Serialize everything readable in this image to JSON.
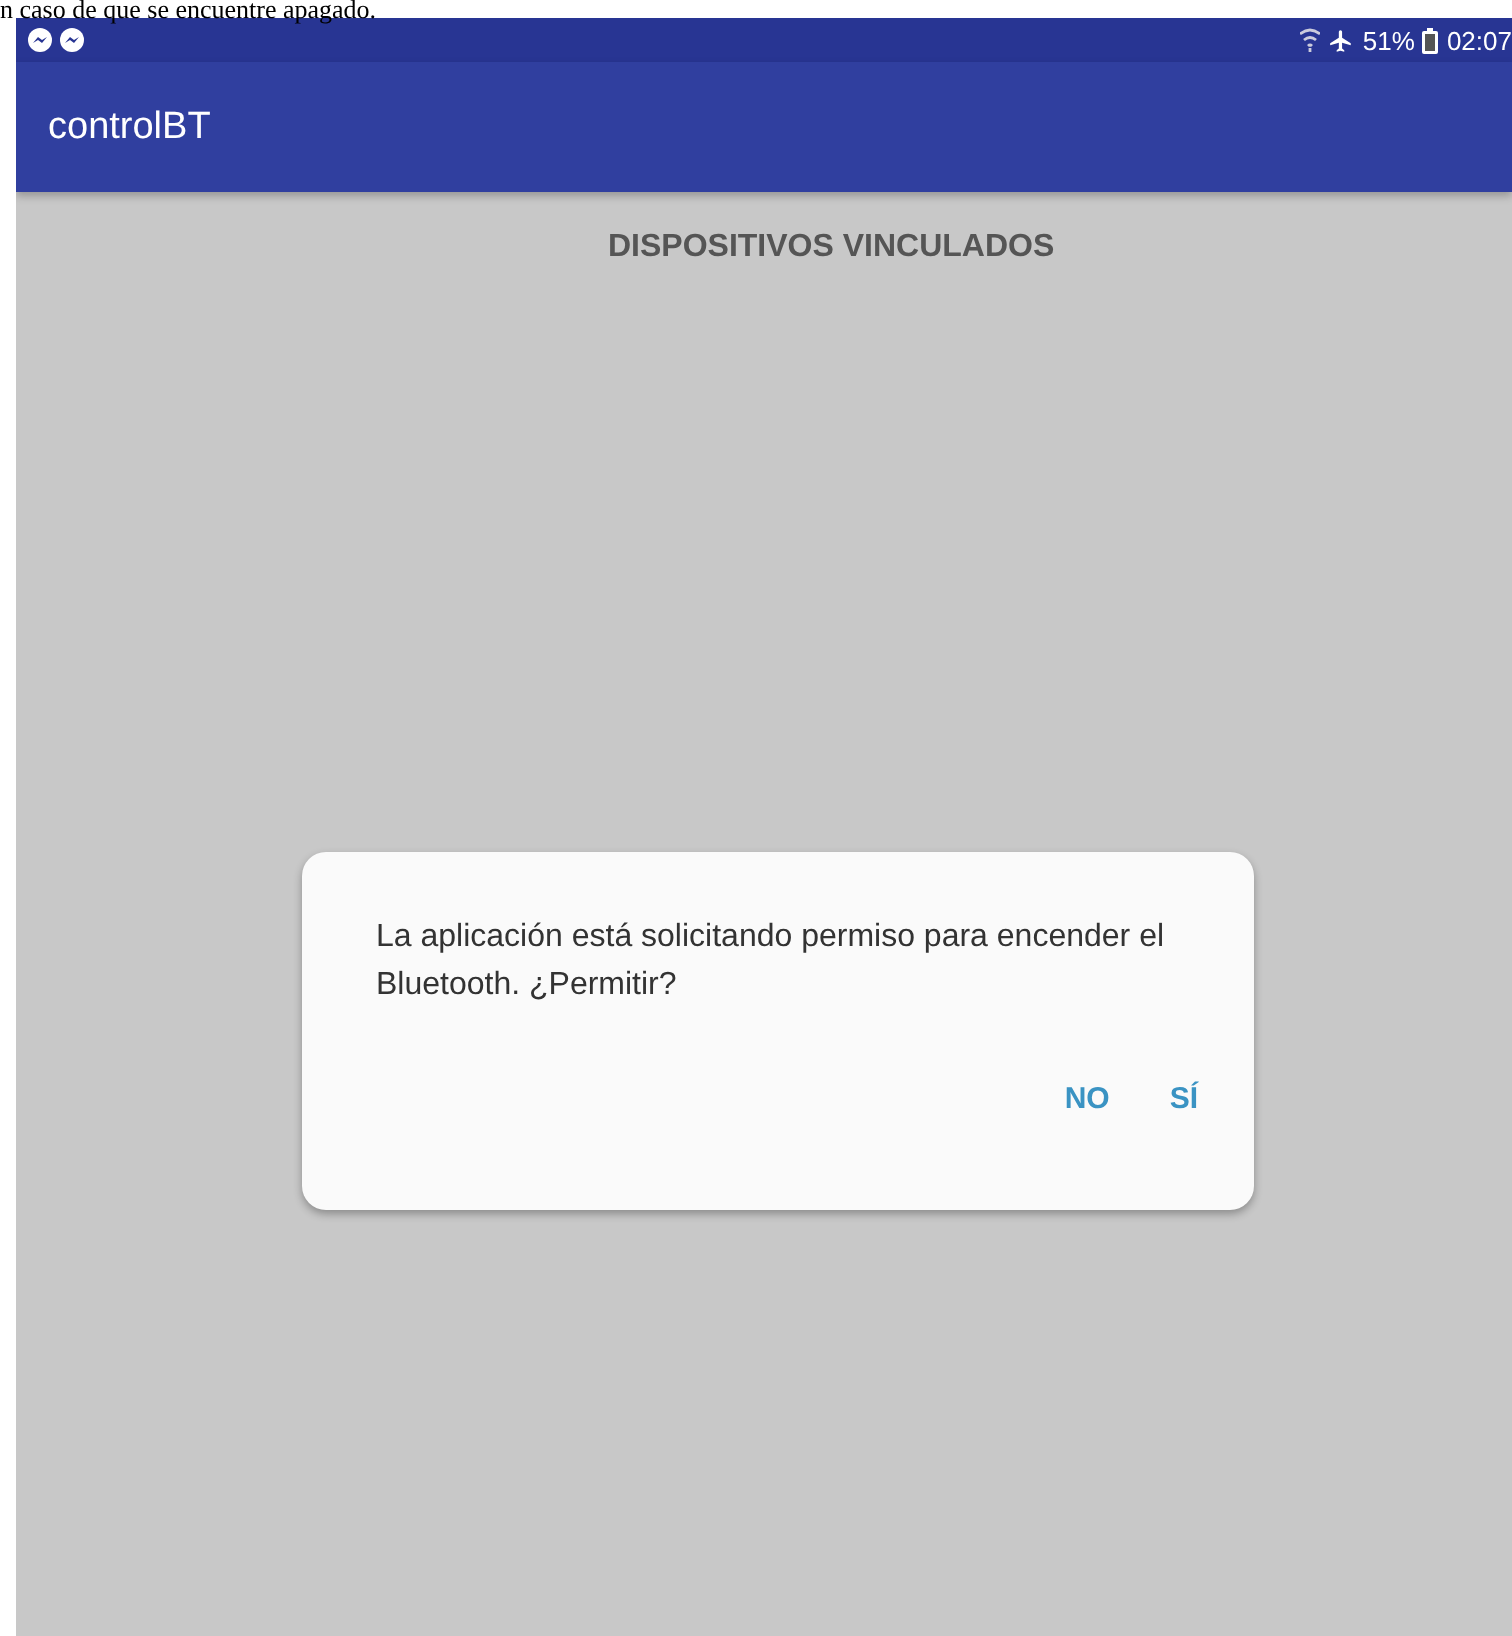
{
  "document_text": "n caso de que se encuentre apagado.",
  "status_bar": {
    "battery": "51%",
    "time": "02:07"
  },
  "app_bar": {
    "title": "controlBT"
  },
  "heading": "DISPOSITIVOS VINCULADOS",
  "dialog": {
    "message": "La aplicación está solicitando permiso para encender el Bluetooth. ¿Permitir?",
    "buttons": [
      {
        "label": "NO"
      },
      {
        "label": "SÍ"
      }
    ]
  }
}
